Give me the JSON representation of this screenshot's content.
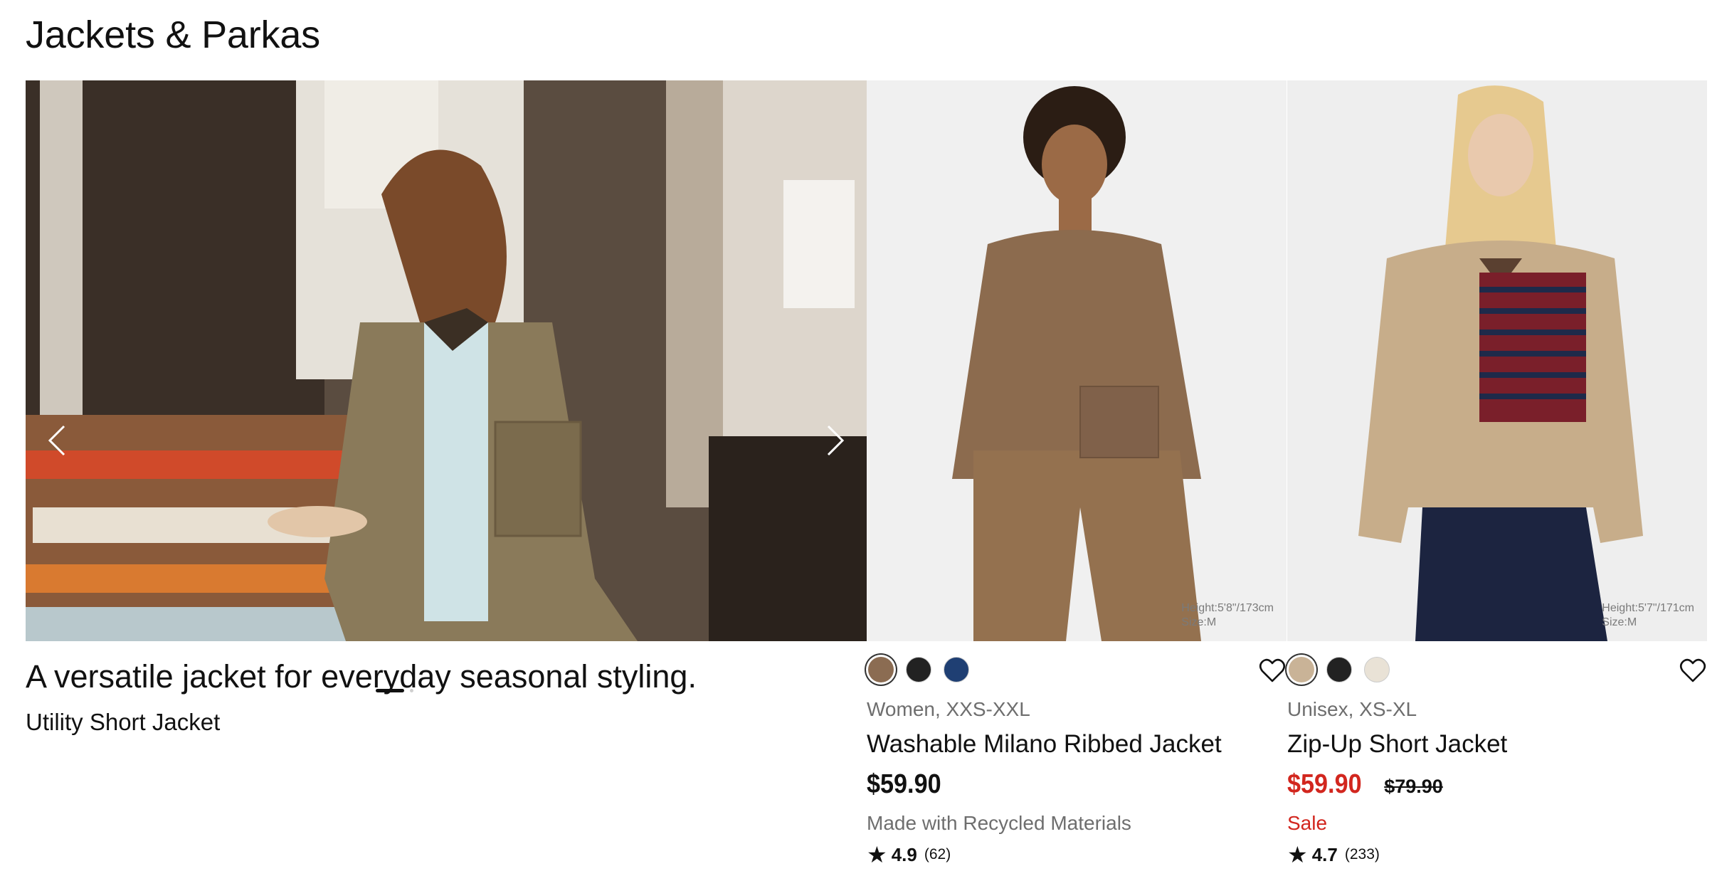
{
  "section": {
    "title": "Jackets & Parkas"
  },
  "feature": {
    "headline": "A versatile jacket for everyday seasonal styling.",
    "product_name": "Utility Short Jacket",
    "prev_icon": "chevron-left-icon",
    "next_icon": "chevron-right-icon",
    "slides_total": 2,
    "active_slide": 1
  },
  "products": [
    {
      "swatches": [
        "#8b6c52",
        "#222222",
        "#1f3f73"
      ],
      "selected_swatch": 0,
      "meta": "Women, XXS-XXL",
      "name": "Washable Milano Ribbed Jacket",
      "price": "$59.90",
      "original_price": "",
      "tagline": "Made with Recycled Materials",
      "rating": "4.9",
      "reviews": "(62)",
      "model_info": [
        "Height:5'8\"/173cm",
        "Size:M"
      ],
      "on_sale": false
    },
    {
      "swatches": [
        "#c9b397",
        "#222222",
        "#e9e2d6"
      ],
      "selected_swatch": 0,
      "meta": "Unisex, XS-XL",
      "name": "Zip-Up Short Jacket",
      "price": "$59.90",
      "original_price": "$79.90",
      "tagline": "Sale",
      "rating": "4.7",
      "reviews": "(233)",
      "model_info": [
        "Height:5'7\"/171cm",
        "Size:M"
      ],
      "on_sale": true
    }
  ],
  "colors": {
    "sale": "#d2261e",
    "text": "#111111",
    "muted": "#6e6e6e"
  }
}
